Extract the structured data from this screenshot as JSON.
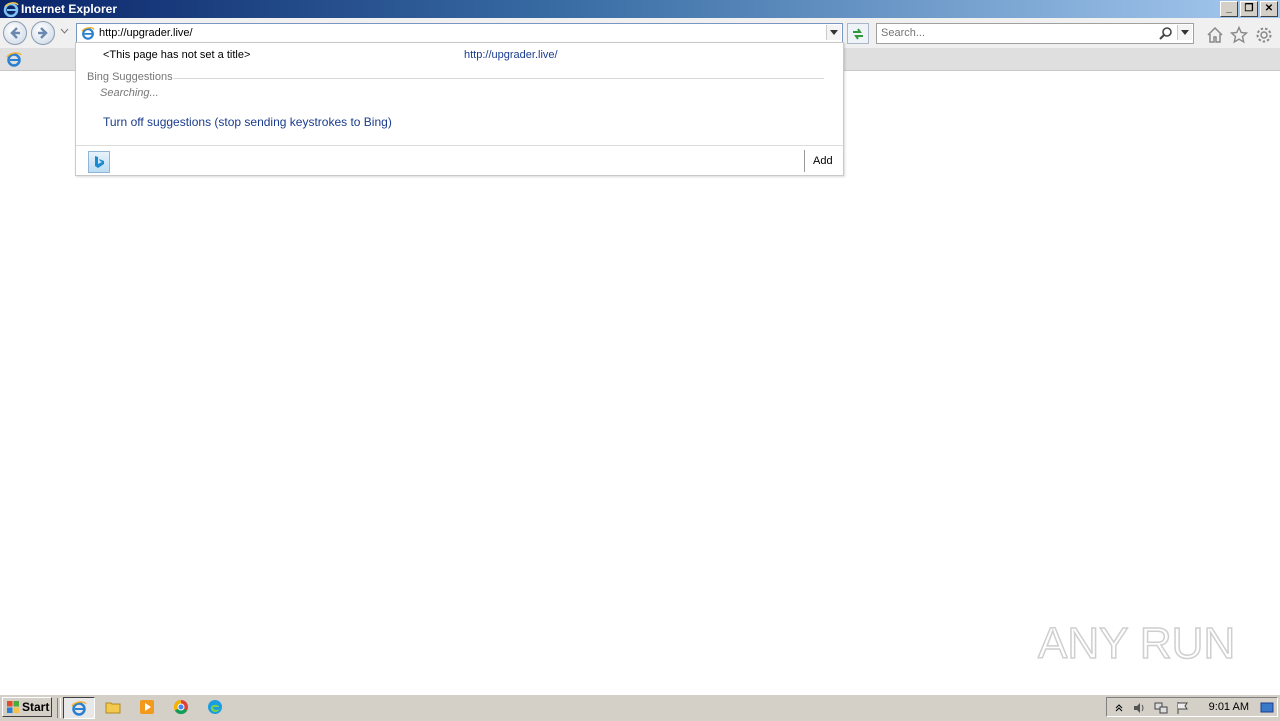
{
  "window": {
    "title": "Internet Explorer",
    "controls": {
      "minimize": "_",
      "restore": "❐",
      "close": "✕"
    }
  },
  "address": {
    "value": "http://upgrader.live/"
  },
  "search": {
    "placeholder": "Search..."
  },
  "dropdown": {
    "history_title": "<This page has not set a title>",
    "history_url": "http://upgrader.live/",
    "section_label": "Bing Suggestions",
    "searching": "Searching...",
    "turn_off": "Turn off suggestions (stop sending keystrokes to Bing)",
    "add_label": "Add"
  },
  "watermark": {
    "text": "ANY RUN"
  },
  "taskbar": {
    "start_label": "Start",
    "clock": "9:01 AM"
  },
  "icons": [
    "ie-icon",
    "back-icon",
    "forward-icon",
    "chevron-down-icon",
    "go-icon",
    "search-icon",
    "home-icon",
    "favorites-star-icon",
    "gear-icon",
    "bing-icon",
    "folder-icon",
    "media-player-icon",
    "chrome-icon",
    "edge-icon",
    "windows-flag-icon",
    "tray-arrow-icon",
    "volume-icon",
    "network-icon",
    "action-center-flag-icon",
    "show-desktop-icon"
  ],
  "colors": {
    "title_gradient_start": "#0a246a",
    "title_gradient_end": "#a6caf0",
    "link": "#1a3c8c",
    "taskbar": "#d4d0c8"
  }
}
